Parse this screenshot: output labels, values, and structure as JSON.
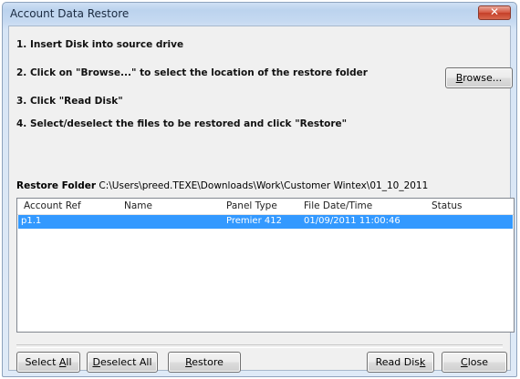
{
  "window": {
    "title": "Account Data Restore",
    "close_glyph": "✕"
  },
  "steps": [
    "1. Insert Disk into source drive",
    "2. Click on \"Browse...\" to select the location of the restore folder",
    "3. Click \"Read Disk\"",
    "4. Select/deselect the files to be restored and click \"Restore\""
  ],
  "browse": {
    "mnemonic": "B",
    "label_rest": "rowse..."
  },
  "restore_folder": {
    "label": "Restore Folder",
    "path": "C:\\Users\\preed.TEXE\\Downloads\\Work\\Customer Wintex\\01_10_2011"
  },
  "table": {
    "columns": [
      "Account Ref",
      "Name",
      "Panel Type",
      "File Date/Time",
      "Status"
    ],
    "rows": [
      {
        "account_ref": "p1.1",
        "name": "",
        "panel_type": "Premier 412",
        "file_datetime": "01/09/2011 11:00:46",
        "status": ""
      }
    ],
    "selected_row_color": "#3399ff"
  },
  "buttons": {
    "select_all": {
      "mnemonic": "",
      "pre": "Select ",
      "post": "",
      "under": "A",
      "tail": "ll"
    },
    "deselect_all": {
      "under": "D",
      "tail": "eselect All"
    },
    "restore": {
      "under": "R",
      "tail": "estore"
    },
    "read_disk": {
      "under": "",
      "pre": "Read Dis",
      "under2": "k"
    },
    "close": {
      "under": "C",
      "tail": "lose"
    }
  },
  "colors": {
    "title_bar": "#c5d9f1",
    "close_button": "#c43f28",
    "selection": "#3399ff"
  }
}
